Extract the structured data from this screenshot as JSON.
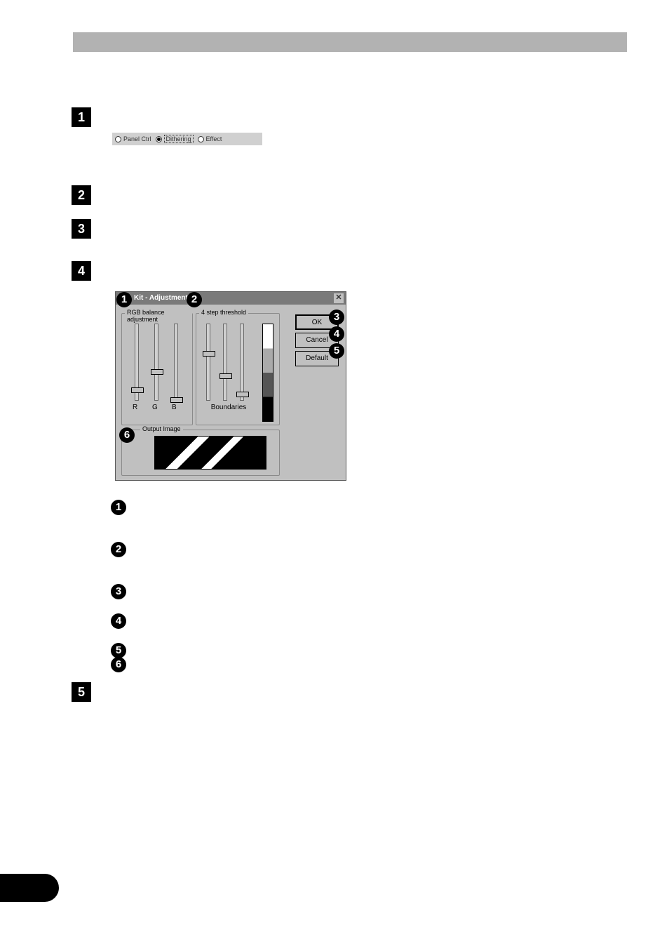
{
  "radiorow": {
    "panel_ctrl": "Panel Ctrl",
    "dithering": "Dithering",
    "effect": "Effect"
  },
  "dialog": {
    "title": "Kit - Adjustment",
    "rgb_group": "RGB balance adjustment",
    "threshold_group": "4 step threshold",
    "output_group": "Output Image",
    "boundaries": "Boundaries",
    "r": "R",
    "g": "G",
    "b": "B",
    "ok": "OK",
    "cancel": "Cancel",
    "default": "Default"
  },
  "steps": {
    "s1": "1",
    "s2": "2",
    "s3": "3",
    "s4": "4",
    "s5": "5"
  },
  "bullets": {
    "b1": "1",
    "b2": "2",
    "b3": "3",
    "b4": "4",
    "b5": "5",
    "b6": "6"
  }
}
